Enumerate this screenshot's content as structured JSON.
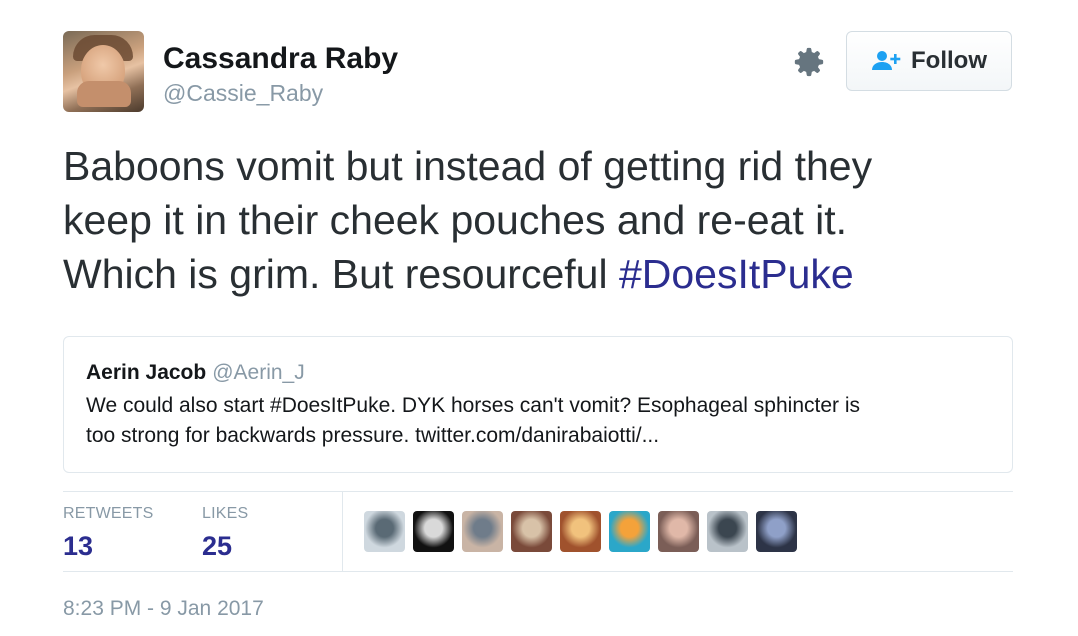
{
  "author": {
    "name": "Cassandra Raby",
    "handle": "@Cassie_Raby"
  },
  "actions": {
    "follow_label": "Follow"
  },
  "tweet": {
    "lines": [
      "Baboons vomit but instead of getting rid they",
      "keep it in their cheek pouches and re-eat it.",
      "Which is grim. But resourceful "
    ],
    "hashtag": "#DoesItPuke"
  },
  "quoted_tweet": {
    "name": "Aerin Jacob",
    "handle": "@Aerin_J",
    "lines": [
      "We could also start #DoesItPuke. DYK horses can't vomit? Esophageal sphincter is",
      "too strong for backwards pressure. twitter.com/danirabaiotti/..."
    ]
  },
  "stats": {
    "retweets_label": "RETWEETS",
    "retweets_count": "13",
    "likes_label": "LIKES",
    "likes_count": "25"
  },
  "liker_avatar_colors": [
    [
      "#cfd8df",
      "#5a6a75"
    ],
    [
      "#111111",
      "#d9d9d9"
    ],
    [
      "#c9b4a5",
      "#6f7c8a"
    ],
    [
      "#7a4a3a",
      "#d8c2a8"
    ],
    [
      "#a0522d",
      "#f1c27d"
    ],
    [
      "#2ba7c9",
      "#f4a23a"
    ],
    [
      "#7b5e57",
      "#e0b8a8"
    ],
    [
      "#b9c2c9",
      "#3b4650"
    ],
    [
      "#2d3447",
      "#8fa0c8"
    ]
  ],
  "timestamp": "8:23 PM - 9 Jan 2017",
  "colors": {
    "hashtag_link": "#2b2d8f",
    "follow_icon": "#1da1f2",
    "secondary_text": "#8899a6"
  }
}
